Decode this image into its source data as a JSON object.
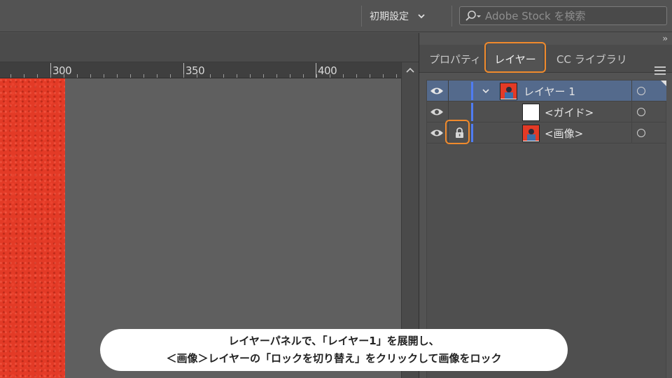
{
  "topbar": {
    "workspace_label": "初期設定",
    "stock_search_placeholder": "Adobe Stock を検索"
  },
  "ruler": {
    "labels": [
      "300",
      "350",
      "400"
    ]
  },
  "panel": {
    "collapse_glyph": "››",
    "tabs": [
      {
        "label": "プロパティ",
        "active": false
      },
      {
        "label": "レイヤー",
        "active": true
      },
      {
        "label": "CC ライブラリ",
        "active": false
      }
    ]
  },
  "layers": [
    {
      "name": "レイヤー 1",
      "selected": true,
      "expanded": true,
      "locked": false,
      "thumbnail": "photo-thumbnail",
      "layer_color": "#4f7cf2"
    },
    {
      "name": "<ガイド>",
      "selected": false,
      "locked": false,
      "thumbnail": "blank-thumbnail",
      "layer_color": "#4f7cf2"
    },
    {
      "name": "<画像>",
      "selected": false,
      "locked": true,
      "thumbnail": "photo-thumbnail",
      "layer_color": "#4f7cf2"
    }
  ],
  "caption": {
    "line1": "レイヤーパネルで、「レイヤー1」を展開し、",
    "line2": "＜画像＞レイヤーの「ロックを切り替え」をクリックして画像をロック"
  },
  "colors": {
    "highlight": "#f08a2c",
    "layer_color": "#4f7cf2",
    "artwork": "#e33a26"
  }
}
